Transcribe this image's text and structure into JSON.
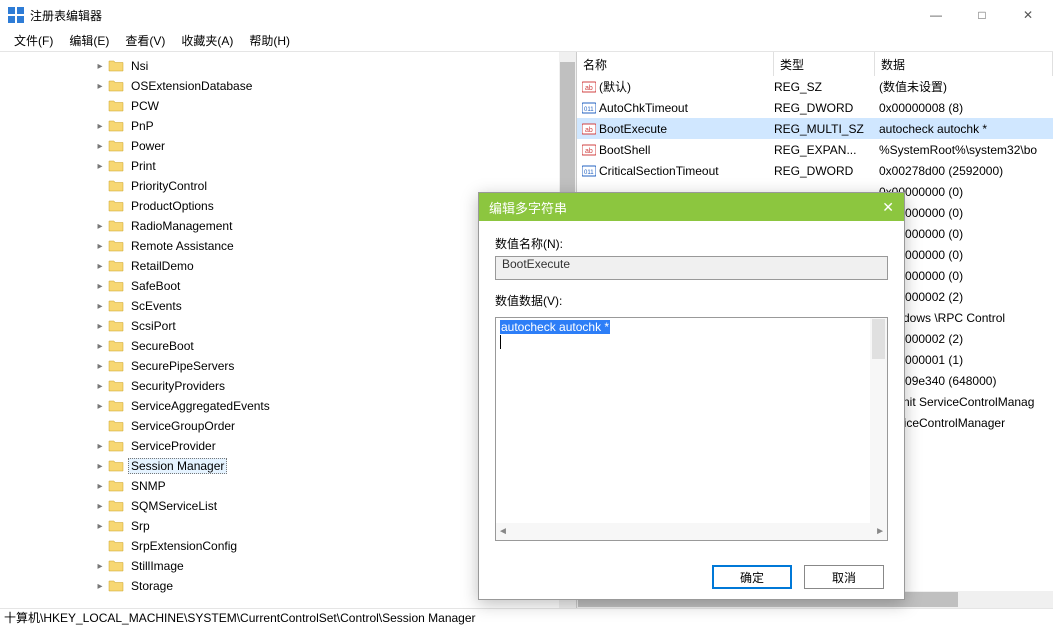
{
  "window": {
    "title": "注册表编辑器"
  },
  "winbuttons": {
    "min": "—",
    "max": "□",
    "close": "✕"
  },
  "menu": {
    "file": "文件(F)",
    "edit": "编辑(E)",
    "view": "查看(V)",
    "fav": "收藏夹(A)",
    "help": "帮助(H)"
  },
  "tree": {
    "items": [
      {
        "indent": 92,
        "chev": ">",
        "label": "Nsi"
      },
      {
        "indent": 92,
        "chev": ">",
        "label": "OSExtensionDatabase"
      },
      {
        "indent": 92,
        "chev": "",
        "label": "PCW"
      },
      {
        "indent": 92,
        "chev": ">",
        "label": "PnP"
      },
      {
        "indent": 92,
        "chev": ">",
        "label": "Power"
      },
      {
        "indent": 92,
        "chev": ">",
        "label": "Print"
      },
      {
        "indent": 92,
        "chev": "",
        "label": "PriorityControl"
      },
      {
        "indent": 92,
        "chev": "",
        "label": "ProductOptions"
      },
      {
        "indent": 92,
        "chev": ">",
        "label": "RadioManagement"
      },
      {
        "indent": 92,
        "chev": ">",
        "label": "Remote Assistance"
      },
      {
        "indent": 92,
        "chev": ">",
        "label": "RetailDemo"
      },
      {
        "indent": 92,
        "chev": ">",
        "label": "SafeBoot"
      },
      {
        "indent": 92,
        "chev": ">",
        "label": "ScEvents"
      },
      {
        "indent": 92,
        "chev": ">",
        "label": "ScsiPort"
      },
      {
        "indent": 92,
        "chev": ">",
        "label": "SecureBoot"
      },
      {
        "indent": 92,
        "chev": ">",
        "label": "SecurePipeServers"
      },
      {
        "indent": 92,
        "chev": ">",
        "label": "SecurityProviders"
      },
      {
        "indent": 92,
        "chev": ">",
        "label": "ServiceAggregatedEvents"
      },
      {
        "indent": 92,
        "chev": "",
        "label": "ServiceGroupOrder"
      },
      {
        "indent": 92,
        "chev": ">",
        "label": "ServiceProvider"
      },
      {
        "indent": 92,
        "chev": ">",
        "label": "Session Manager",
        "selected": true
      },
      {
        "indent": 92,
        "chev": ">",
        "label": "SNMP"
      },
      {
        "indent": 92,
        "chev": ">",
        "label": "SQMServiceList"
      },
      {
        "indent": 92,
        "chev": ">",
        "label": "Srp"
      },
      {
        "indent": 92,
        "chev": "",
        "label": "SrpExtensionConfig"
      },
      {
        "indent": 92,
        "chev": ">",
        "label": "StillImage"
      },
      {
        "indent": 92,
        "chev": ">",
        "label": "Storage"
      }
    ]
  },
  "val_headers": {
    "name": "名称",
    "type": "类型",
    "data": "数据"
  },
  "values": [
    {
      "icon": "str",
      "name": "(默认)",
      "type": "REG_SZ",
      "data": "(数值未设置)"
    },
    {
      "icon": "num",
      "name": "AutoChkTimeout",
      "type": "REG_DWORD",
      "data": "0x00000008 (8)"
    },
    {
      "icon": "str",
      "name": "BootExecute",
      "type": "REG_MULTI_SZ",
      "data": "autocheck autochk *",
      "selected": true
    },
    {
      "icon": "str",
      "name": "BootShell",
      "type": "REG_EXPAN...",
      "data": "%SystemRoot%\\system32\\bo"
    },
    {
      "icon": "num",
      "name": "CriticalSectionTimeout",
      "type": "REG_DWORD",
      "data": "0x00278d00 (2592000)"
    },
    {
      "icon": "",
      "name": "",
      "type": "",
      "data": "0x00000000 (0)"
    },
    {
      "icon": "",
      "name": "",
      "type": "",
      "data": "0x00000000 (0)"
    },
    {
      "icon": "",
      "name": "",
      "type": "",
      "data": "0x00000000 (0)"
    },
    {
      "icon": "",
      "name": "",
      "type": "",
      "data": "0x00000000 (0)"
    },
    {
      "icon": "",
      "name": "",
      "type": "",
      "data": "0x00000000 (0)"
    },
    {
      "icon": "",
      "name": "",
      "type": "",
      "data": "0x00000002 (2)"
    },
    {
      "icon": "",
      "name": "",
      "type": "",
      "data": "\\Windows \\RPC Control"
    },
    {
      "icon": "",
      "name": "",
      "type": "",
      "data": "0x00000002 (2)"
    },
    {
      "icon": "",
      "name": "",
      "type": "",
      "data": "0x00000001 (1)"
    },
    {
      "icon": "",
      "name": "",
      "type": "",
      "data": "0x0009e340 (648000)"
    },
    {
      "icon": "",
      "name": "",
      "type": "",
      "data": "WinInit ServiceControlManag"
    },
    {
      "icon": "",
      "name": "",
      "type": "",
      "data": "ServiceControlManager"
    }
  ],
  "status": "十算机\\HKEY_LOCAL_MACHINE\\SYSTEM\\CurrentControlSet\\Control\\Session Manager",
  "dialog": {
    "title": "编辑多字符串",
    "name_label": "数值名称(N):",
    "name_value": "BootExecute",
    "data_label": "数值数据(V):",
    "data_value": "autocheck autochk *",
    "ok": "确定",
    "cancel": "取消"
  }
}
